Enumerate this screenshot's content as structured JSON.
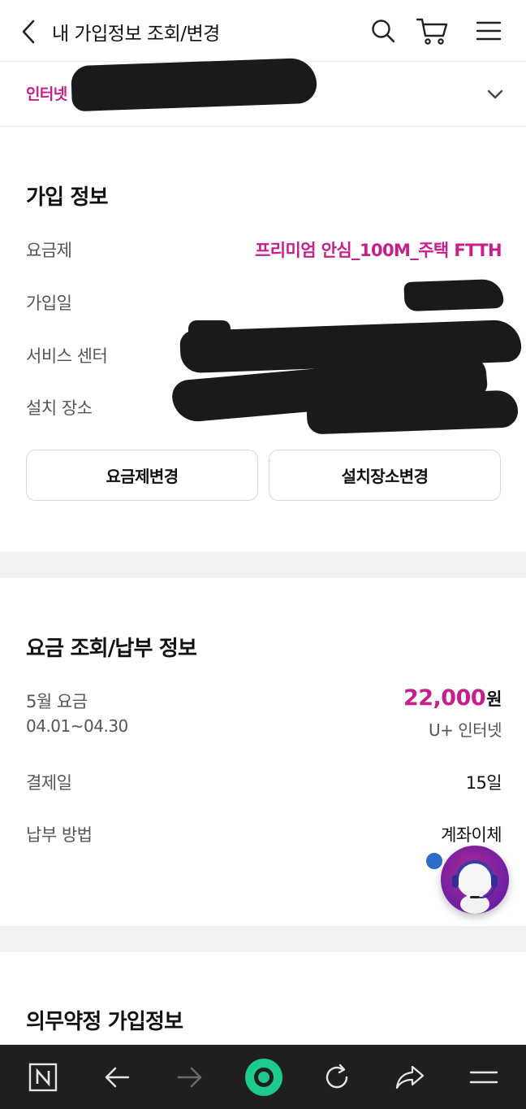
{
  "header": {
    "title": "내 가입정보 조회/변경",
    "icons": [
      "back-icon",
      "search-icon",
      "cart-icon",
      "hamburger-icon"
    ]
  },
  "product_select": {
    "label": "인터넷"
  },
  "subscription": {
    "title": "가입 정보",
    "plan_label": "요금제",
    "plan_value": "프리미엄 안심_100M_주택 FTTH",
    "join_date_label": "가입일",
    "service_center_label": "서비스 센터",
    "install_location_label": "설치 장소",
    "change_plan_button": "요금제변경",
    "change_location_button": "설치장소변경"
  },
  "billing": {
    "title": "요금 조회/납부 정보",
    "month_label": "5월 요금",
    "period": "04.01~04.30",
    "amount": "22,000",
    "currency": "원",
    "product": "U+ 인터넷",
    "due_label": "결제일",
    "due_value": "15일",
    "method_label": "납부 방법",
    "method_value": "계좌이체"
  },
  "contract": {
    "title": "의무약정 가입정보"
  },
  "colors": {
    "accent": "#c81e8c",
    "bottom_bar": "#1f1f1f",
    "home_button": "#1ec98c"
  }
}
